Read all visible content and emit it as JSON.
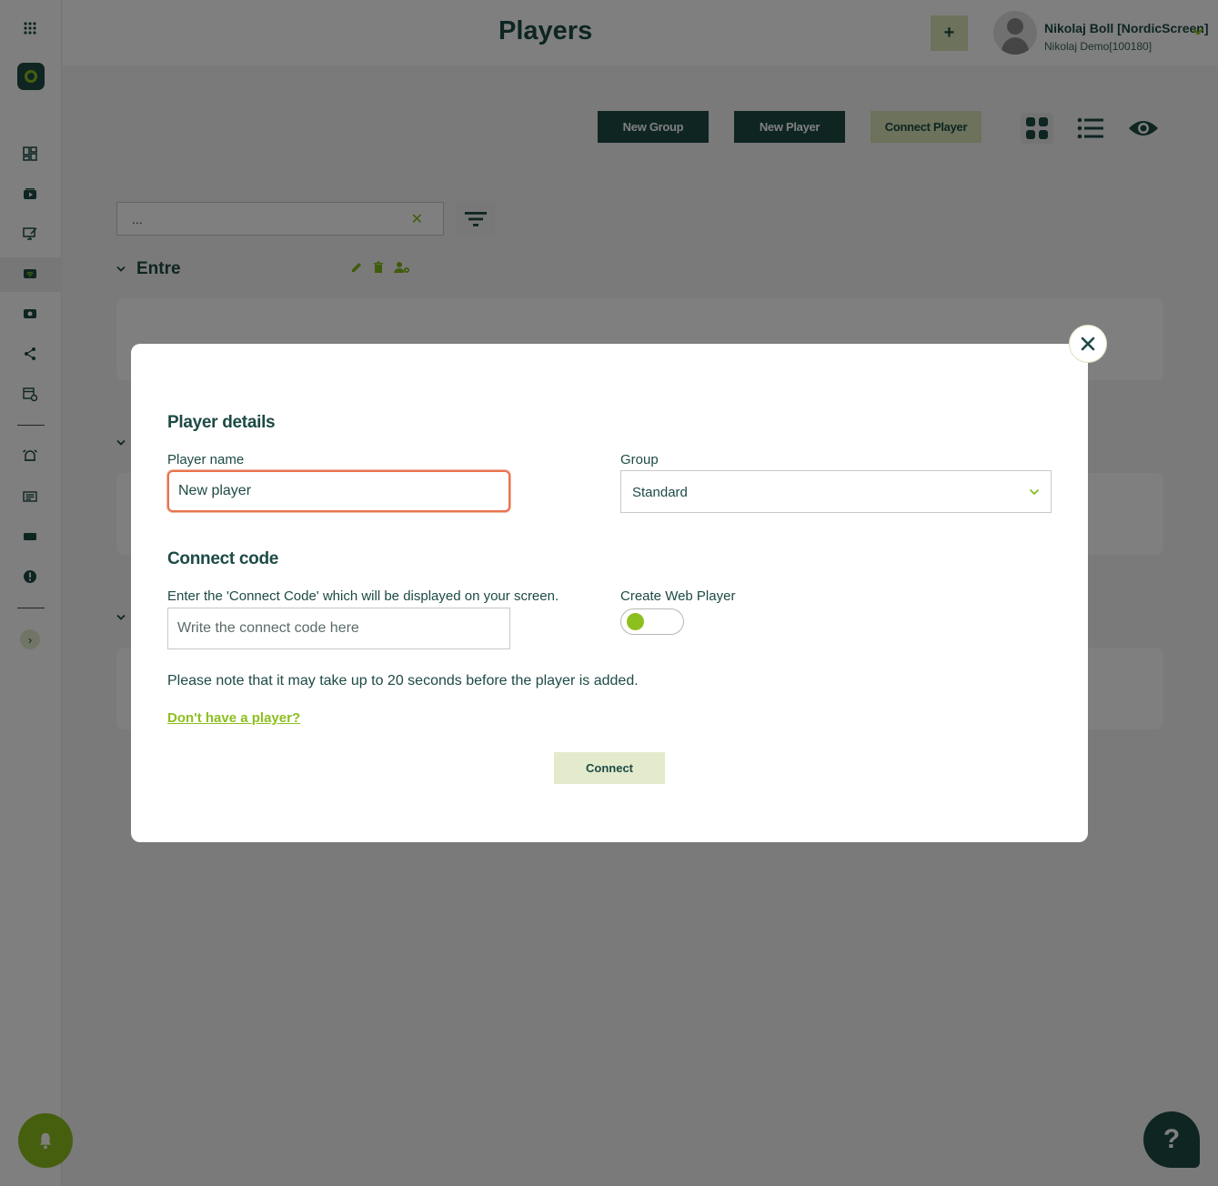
{
  "header": {
    "title": "Players",
    "add_label": "+",
    "user_name": "Nikolaj Boll [NordicScreen]",
    "user_org": "Nikolaj Demo[100180]"
  },
  "toolbar": {
    "new_group": "New Group",
    "new_player": "New Player",
    "connect_player": "Connect Player"
  },
  "search": {
    "value": "..."
  },
  "groups": [
    {
      "title": "Entre"
    }
  ],
  "modal": {
    "section_player": "Player details",
    "player_name_label": "Player name",
    "player_name_value": "New player",
    "group_label": "Group",
    "group_value": "Standard",
    "section_connect": "Connect code",
    "connect_code_label": "Enter the 'Connect Code' which will be displayed on your screen.",
    "connect_code_placeholder": "Write the connect code here",
    "web_player_label": "Create Web Player",
    "note": "Please note that it may take up to 20 seconds before the player is added.",
    "help_link": "Don't have a player?",
    "connect_button": "Connect"
  },
  "help_fab": "?",
  "colors": {
    "primary": "#1d4a45",
    "accent": "#8dbf1f",
    "light_accent": "#d8e5b6",
    "focus": "#e8734f"
  }
}
